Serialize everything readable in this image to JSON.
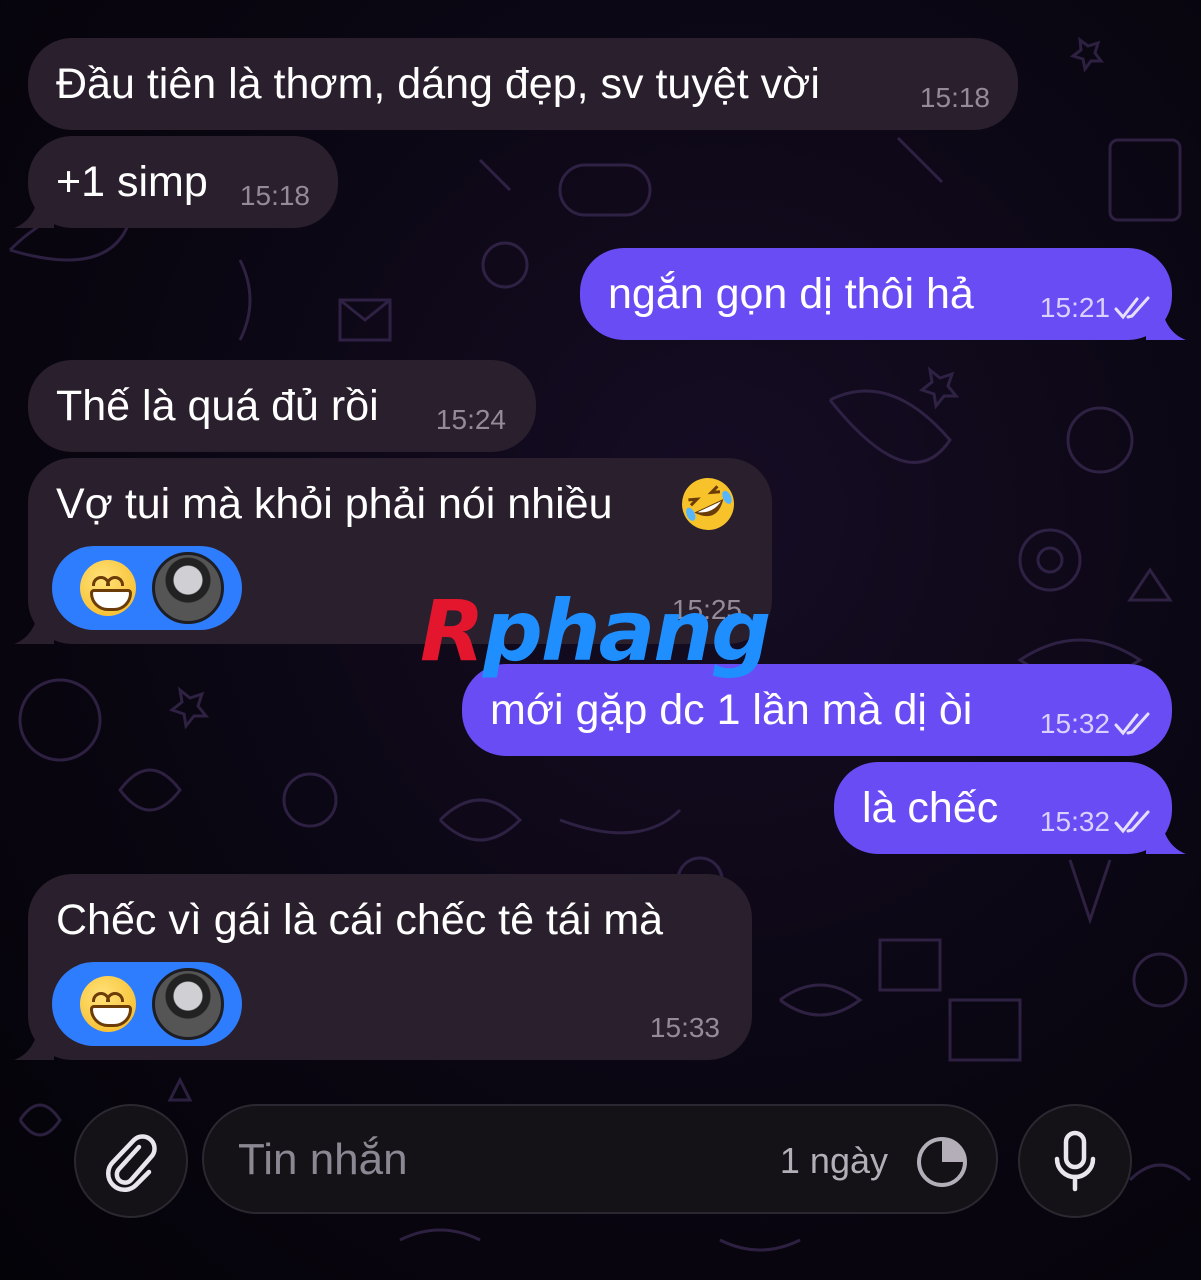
{
  "messages": [
    {
      "id": "m1",
      "direction": "in",
      "text": "Đầu tiên là thơm, dáng đẹp, sv tuyệt vời",
      "time": "15:18"
    },
    {
      "id": "m2",
      "direction": "in",
      "text": "+1 simp",
      "time": "15:18"
    },
    {
      "id": "m3",
      "direction": "out",
      "text": "ngắn gọn dị thôi hả",
      "time": "15:21",
      "status": "read"
    },
    {
      "id": "m4",
      "direction": "in",
      "text": "Thế là quá đủ rồi",
      "time": "15:24"
    },
    {
      "id": "m5",
      "direction": "in",
      "text": "Vợ tui mà khỏi phải nói nhiều",
      "emoji": "rolling-on-floor-laughing",
      "time": "15:25",
      "reaction": {
        "emoji": "grinning-face",
        "reactor": "avatar"
      }
    },
    {
      "id": "m6",
      "direction": "out",
      "text": "mới gặp dc 1 lần mà dị òi",
      "time": "15:32",
      "status": "read"
    },
    {
      "id": "m7",
      "direction": "out",
      "text": "là chếc",
      "time": "15:32",
      "status": "read"
    },
    {
      "id": "m8",
      "direction": "in",
      "text": "Chếc vì gái là cái chếc tê tái mà",
      "time": "15:33",
      "reaction": {
        "emoji": "grinning-face",
        "reactor": "avatar"
      }
    }
  ],
  "watermark": {
    "first": "R",
    "rest": "phang"
  },
  "composer": {
    "placeholder": "Tin nhắn",
    "timer_label": "1 ngày",
    "attach_icon": "paperclip-icon",
    "timer_icon": "timer-icon",
    "mic_icon": "microphone-icon"
  },
  "colors": {
    "incoming_bubble": "#2a1f2c",
    "outgoing_bubble": "#6a4cf5",
    "reaction_pill": "#2f7dff",
    "background": "#0a0612"
  }
}
